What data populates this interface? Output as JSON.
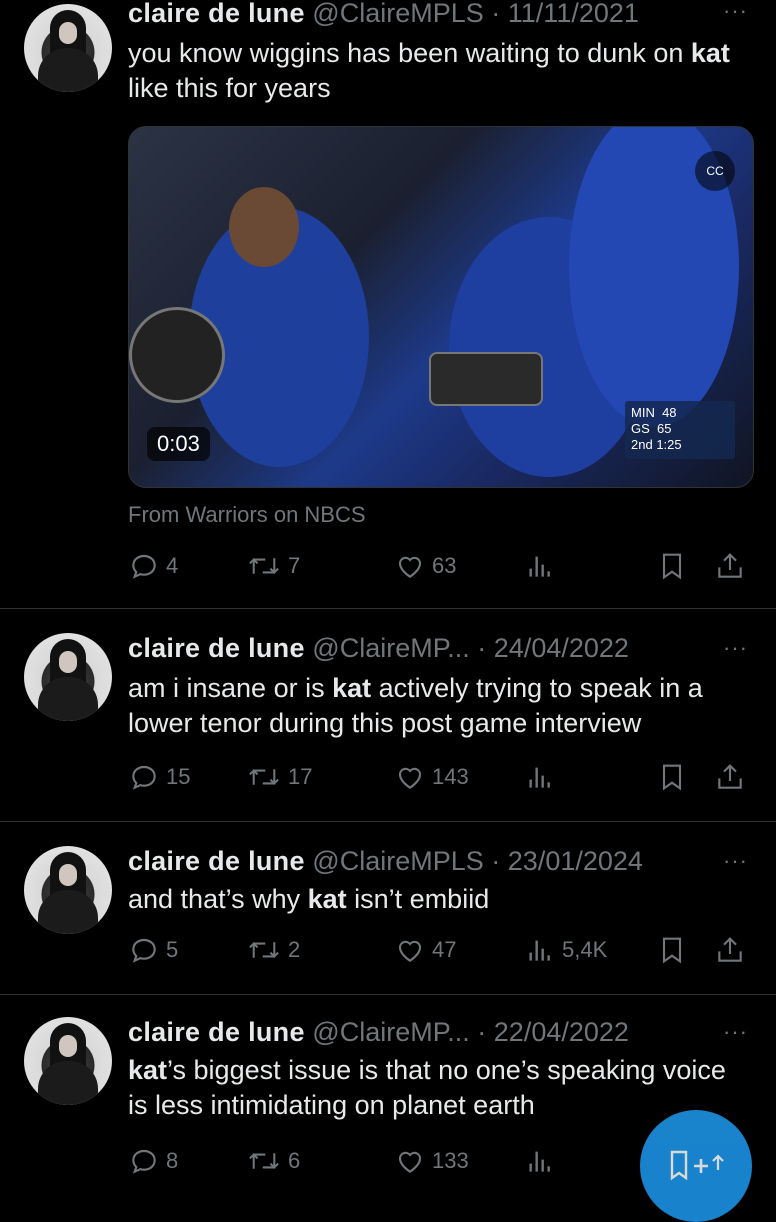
{
  "tweets": [
    {
      "name": "claire de lune",
      "handle": "@ClaireMPLS",
      "sep": "·",
      "date": "11/11/2021",
      "more": "···",
      "text_parts": [
        "you know wiggins has been waiting to dunk on ",
        "kat",
        " like this for years"
      ],
      "media": {
        "time": "0:03",
        "score_team1": "MIN",
        "score1": "48",
        "score_team2": "GS",
        "score2": "65",
        "period": "2nd",
        "clock": "1:25",
        "cc_label": "CC"
      },
      "attribution": "From Warriors on NBCS",
      "replies": "4",
      "reposts": "7",
      "likes": "63",
      "views": ""
    },
    {
      "name": "claire de lune",
      "handle": "@ClaireMP...",
      "sep": "·",
      "date": "24/04/2022",
      "more": "···",
      "text_parts": [
        "am i insane or is ",
        "kat",
        " actively trying to speak in a lower tenor during this post game interview"
      ],
      "replies": "15",
      "reposts": "17",
      "likes": "143",
      "views": ""
    },
    {
      "name": "claire de lune",
      "handle": "@ClaireMPLS",
      "sep": "·",
      "date": "23/01/2024",
      "more": "···",
      "text_parts": [
        "and that’s why ",
        "kat",
        " isn’t embiid"
      ],
      "replies": "5",
      "reposts": "2",
      "likes": "47",
      "views": "5,4K"
    },
    {
      "name": "claire de lune",
      "handle": "@ClaireMP...",
      "sep": "·",
      "date": "22/04/2022",
      "more": "···",
      "text_parts": [
        "",
        "kat",
        "’s biggest issue is that no one’s speaking voice is less intimidating on planet earth"
      ],
      "replies": "8",
      "reposts": "6",
      "likes": "133",
      "views": ""
    }
  ],
  "icons": {
    "reply": "reply-icon",
    "repost": "repost-icon",
    "like": "heart-icon",
    "views": "views-icon",
    "bookmark": "bookmark-icon",
    "share": "share-icon",
    "compose": "compose-post-icon"
  },
  "colors": {
    "background": "#000000",
    "text": "#e7e9ea",
    "muted": "#71767b",
    "accent": "#1d9bf0",
    "divider": "#2f3336"
  }
}
